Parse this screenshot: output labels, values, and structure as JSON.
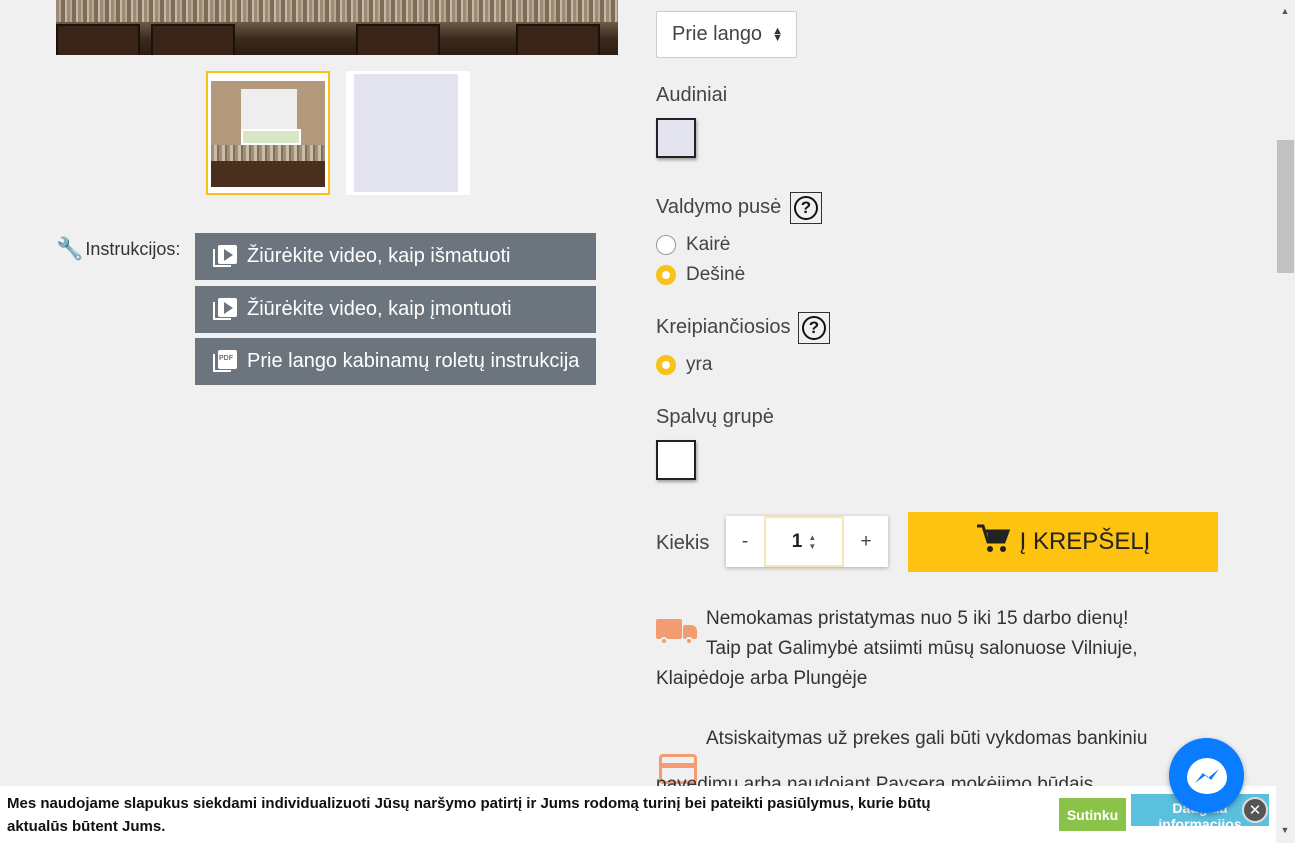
{
  "gallery": {
    "thumbnails": [
      "kitchen-window-roller-blind",
      "fabric-sample"
    ]
  },
  "instructions": {
    "label": "Instrukcijos:",
    "buttons": [
      {
        "label": "Žiūrėkite video, kaip išmatuoti",
        "icon": "video-play-icon"
      },
      {
        "label": "Žiūrėkite video, kaip įmontuoti",
        "icon": "video-play-icon"
      },
      {
        "label": "Prie lango kabinamų roletų instrukcija",
        "icon": "pdf-icon"
      }
    ]
  },
  "options": {
    "mount_select": {
      "value": "Prie lango"
    },
    "fabrics": {
      "label": "Audiniai",
      "swatch_color": "#e4e3f0"
    },
    "control_side": {
      "label": "Valdymo pusė",
      "help": "?",
      "choices": [
        {
          "label": "Kairė",
          "selected": false
        },
        {
          "label": "Dešinė",
          "selected": true
        }
      ]
    },
    "guides": {
      "label": "Kreipiančiosios",
      "help": "?",
      "choices": [
        {
          "label": "yra",
          "selected": true
        }
      ]
    },
    "color_group": {
      "label": "Spalvų grupė",
      "swatch_color": "#ffffff"
    }
  },
  "purchase": {
    "quantity_label": "Kiekis",
    "minus": "-",
    "plus": "+",
    "quantity": "1",
    "cart_button": "Į KREPŠELĮ",
    "cart_icon": "shopping-cart-icon"
  },
  "info": {
    "delivery_lines": [
      "Nemokamas pristatymas nuo 5 iki 15 darbo dienų!",
      "Taip pat Galimybė atsiimti mūsų salonuose Vilniuje,",
      "Klaipėdoje arba Plungėje"
    ],
    "payment_lines": [
      "Atsiskaitymas už prekes gali būti vykdomas bankiniu",
      "pavedimu arba naudojant Paysera mokėjimo būdais"
    ]
  },
  "cookie": {
    "text_line1": "Mes naudojame slapukus siekdami individualizuoti Jūsų naršymo patirtį ir Jums rodomą turinį bei pateikti pasiūlymus, kurie būtų",
    "text_line2": "aktualūs būtent Jums.",
    "agree": "Sutinku",
    "more": "Daugiau informacijos",
    "close": "✕"
  },
  "colors": {
    "accent": "#fec211",
    "instr_button": "#6c757d",
    "info_icon": "#f39b71",
    "messenger": "#0a7cff",
    "agree": "#8bc34a",
    "more": "#5bc0de"
  }
}
